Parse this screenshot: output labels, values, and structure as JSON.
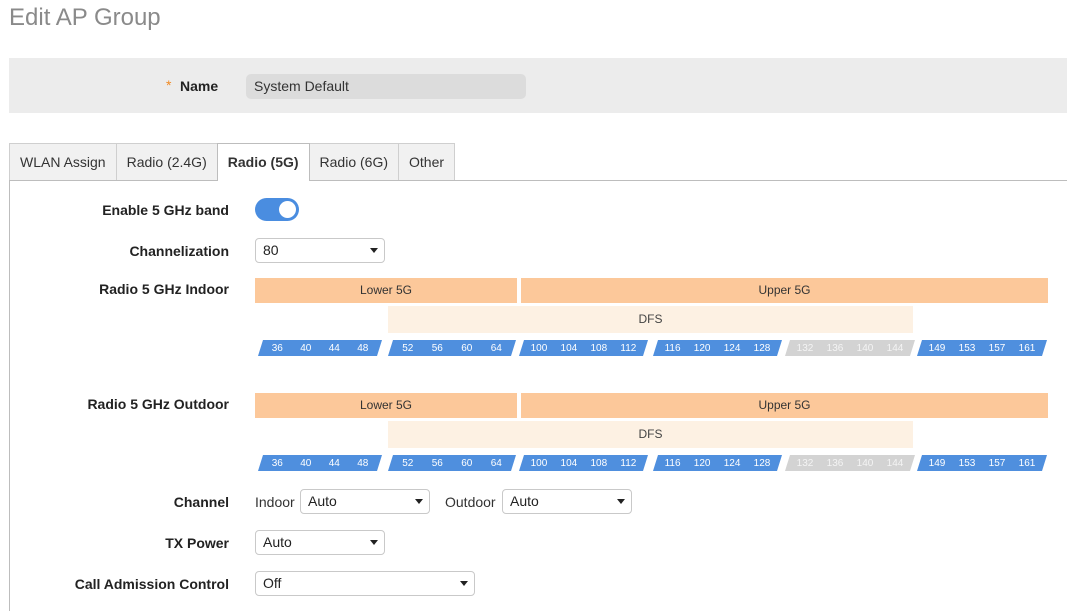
{
  "page_title": "Edit AP Group",
  "name_field": {
    "required_mark": "*",
    "label": "Name",
    "value": "System Default"
  },
  "tabs": [
    {
      "label": "WLAN Assign",
      "active": false
    },
    {
      "label": "Radio (2.4G)",
      "active": false
    },
    {
      "label": "Radio (5G)",
      "active": true
    },
    {
      "label": "Radio (6G)",
      "active": false
    },
    {
      "label": "Other",
      "active": false
    }
  ],
  "enable_band": {
    "label": "Enable 5 GHz band",
    "on": true
  },
  "channelization": {
    "label": "Channelization",
    "value": "80"
  },
  "indoor": {
    "label": "Radio 5 GHz Indoor",
    "lower": "Lower 5G",
    "upper": "Upper 5G",
    "dfs": "DFS",
    "groups": [
      {
        "channels": [
          "36",
          "40",
          "44",
          "48"
        ],
        "state": "enabled"
      },
      {
        "channels": [
          "52",
          "56",
          "60",
          "64"
        ],
        "state": "enabled"
      },
      {
        "channels": [
          "100",
          "104",
          "108",
          "112"
        ],
        "state": "enabled"
      },
      {
        "channels": [
          "116",
          "120",
          "124",
          "128"
        ],
        "state": "enabled"
      },
      {
        "channels": [
          "132",
          "136",
          "140",
          "144"
        ],
        "state": "disabled"
      },
      {
        "channels": [
          "149",
          "153",
          "157",
          "161"
        ],
        "state": "enabled"
      }
    ]
  },
  "outdoor": {
    "label": "Radio 5 GHz Outdoor",
    "lower": "Lower 5G",
    "upper": "Upper 5G",
    "dfs": "DFS",
    "groups": [
      {
        "channels": [
          "36",
          "40",
          "44",
          "48"
        ],
        "state": "enabled"
      },
      {
        "channels": [
          "52",
          "56",
          "60",
          "64"
        ],
        "state": "enabled"
      },
      {
        "channels": [
          "100",
          "104",
          "108",
          "112"
        ],
        "state": "enabled"
      },
      {
        "channels": [
          "116",
          "120",
          "124",
          "128"
        ],
        "state": "enabled"
      },
      {
        "channels": [
          "132",
          "136",
          "140",
          "144"
        ],
        "state": "disabled"
      },
      {
        "channels": [
          "149",
          "153",
          "157",
          "161"
        ],
        "state": "enabled"
      }
    ]
  },
  "channel": {
    "label": "Channel",
    "indoor_label": "Indoor",
    "indoor_value": "Auto",
    "outdoor_label": "Outdoor",
    "outdoor_value": "Auto"
  },
  "tx_power": {
    "label": "TX Power",
    "value": "Auto"
  },
  "cac": {
    "label": "Call Admission Control",
    "value": "Off"
  },
  "colors": {
    "accent": "#4a8de0",
    "band": "#fcc89a",
    "dfs": "#fdf1e3",
    "channel_enabled": "#4f8fde",
    "channel_disabled": "#d3d3d3",
    "required": "#f08a24"
  }
}
